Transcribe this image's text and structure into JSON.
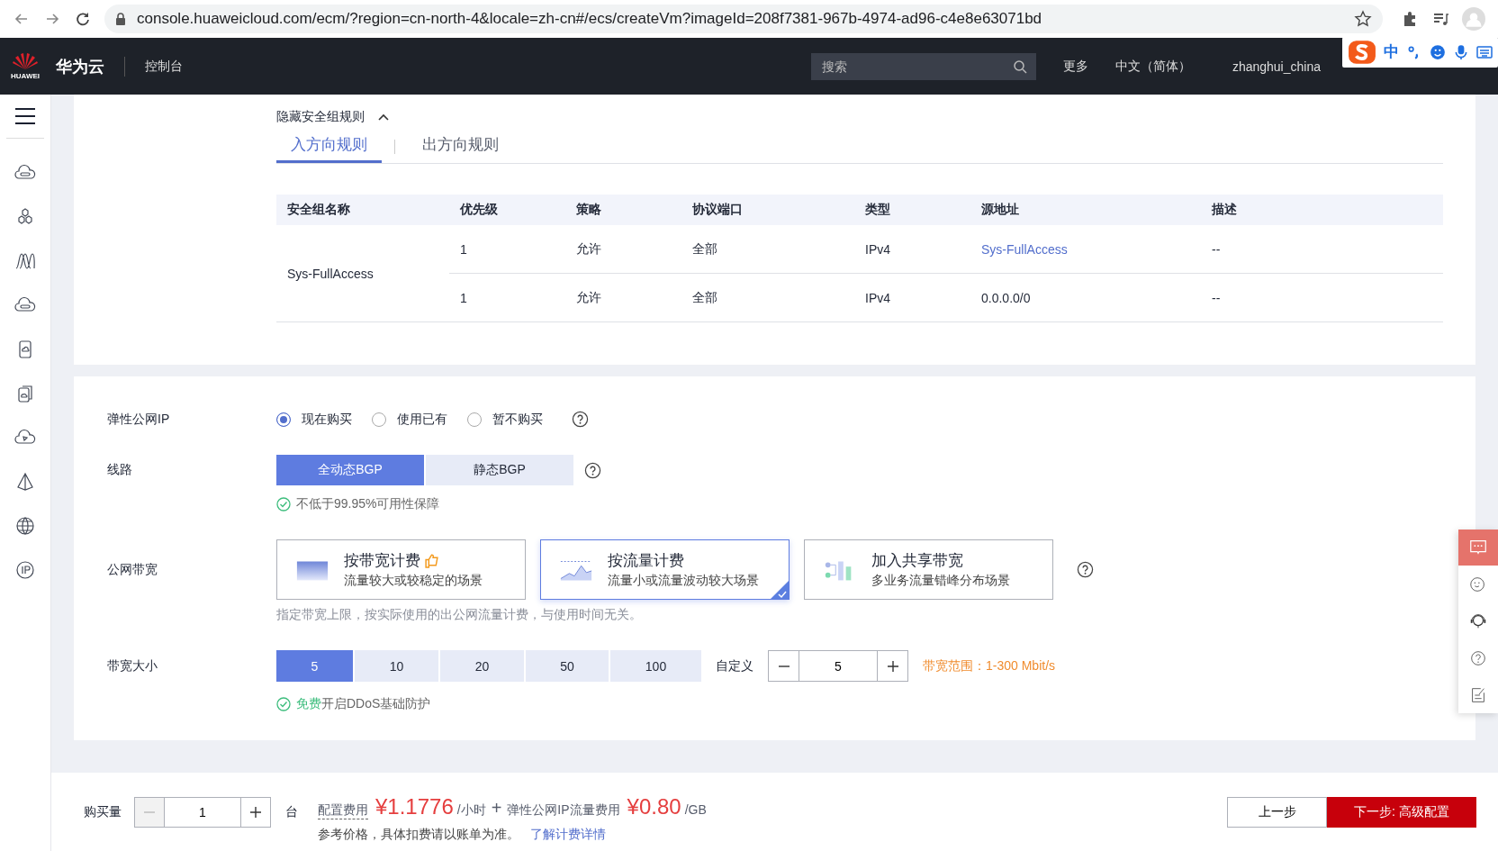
{
  "browser": {
    "url": "console.huaweicloud.com/ecm/?region=cn-north-4&locale=zh-cn#/ecs/createVm?imageId=208f7381-967b-4974-ad96-c4e8e63071bd"
  },
  "header": {
    "logo_text": "HUAWEI",
    "brand": "华为云",
    "console": "控制台",
    "search_placeholder": "搜索",
    "more": "更多",
    "language": "中文（简体）",
    "user": "zhanghui_china",
    "ime_lang": "中"
  },
  "security_group": {
    "toggle": "隐藏安全组规则",
    "expanded": true,
    "tabs": [
      {
        "label": "入方向规则",
        "selected": true
      },
      {
        "label": "出方向规则",
        "selected": false
      }
    ],
    "columns": [
      "安全组名称",
      "优先级",
      "策略",
      "协议端口",
      "类型",
      "源地址",
      "描述"
    ],
    "group_name": "Sys-FullAccess",
    "rows": [
      {
        "priority": "1",
        "policy": "允许",
        "port": "全部",
        "type": "IPv4",
        "source": "Sys-FullAccess",
        "source_is_link": true,
        "description": "--"
      },
      {
        "priority": "1",
        "policy": "允许",
        "port": "全部",
        "type": "IPv4",
        "source": "0.0.0.0/0",
        "source_is_link": false,
        "description": "--"
      }
    ]
  },
  "eip": {
    "label": "弹性公网IP",
    "options": [
      {
        "label": "现在购买",
        "selected": true
      },
      {
        "label": "使用已有",
        "selected": false
      },
      {
        "label": "暂不购买",
        "selected": false
      }
    ]
  },
  "line": {
    "label": "线路",
    "options": [
      {
        "label": "全动态BGP",
        "selected": true
      },
      {
        "label": "静态BGP",
        "selected": false
      }
    ],
    "note": "不低于99.95%可用性保障"
  },
  "billing": {
    "label": "公网带宽",
    "cards": [
      {
        "kind": "bandwidth",
        "title": "按带宽计费",
        "recommended": true,
        "desc": "流量较大或较稳定的场景",
        "selected": false
      },
      {
        "kind": "traffic",
        "title": "按流量计费",
        "recommended": false,
        "desc": "流量小或流量波动较大场景",
        "selected": true
      },
      {
        "kind": "shared",
        "title": "加入共享带宽",
        "recommended": false,
        "desc": "多业务流量错峰分布场景",
        "selected": false
      }
    ],
    "note": "指定带宽上限，按实际使用的出公网流量计费，与使用时间无关。"
  },
  "size": {
    "label": "带宽大小",
    "options": [
      {
        "label": "5",
        "selected": true
      },
      {
        "label": "10",
        "selected": false
      },
      {
        "label": "20",
        "selected": false
      },
      {
        "label": "50",
        "selected": false
      },
      {
        "label": "100",
        "selected": false
      }
    ],
    "custom_label": "自定义",
    "value": "5",
    "range": "带宽范围：1-300 Mbit/s",
    "ddos_free": "免费",
    "ddos_text": "开启DDoS基础防护"
  },
  "footer": {
    "quantity_label": "购买量",
    "quantity": "1",
    "unit": "台",
    "config_fee_label": "配置费用",
    "config_fee": "¥1.1776",
    "config_fee_unit": "/小时",
    "plus": "+",
    "traffic_fee_label": "弹性公网IP流量费用",
    "traffic_fee": "¥0.80",
    "traffic_fee_unit": "/GB",
    "note": "参考价格，具体扣费请以账单为准。",
    "link": "了解计费详情",
    "prev": "上一步",
    "next": "下一步: 高级配置"
  }
}
